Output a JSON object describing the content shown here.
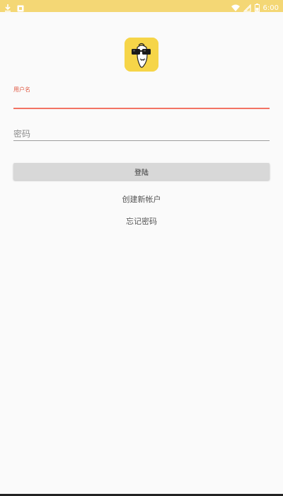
{
  "status_bar": {
    "time": "6:00",
    "color": "#f4d775",
    "left_icons": [
      "download-icon",
      "notification-app-icon"
    ],
    "right_icons": [
      "wifi-icon",
      "signal-icon",
      "battery-icon"
    ]
  },
  "app": {
    "icon": "app-logo-icon",
    "icon_color": "#f6d548"
  },
  "login_form": {
    "username_label": "用户名",
    "username_value": "",
    "password_placeholder": "密码",
    "login_button_label": "登陆",
    "accent_color": "#e05b45"
  },
  "links": {
    "create_account": "创建新帐户",
    "forgot_password": "忘记密码"
  }
}
